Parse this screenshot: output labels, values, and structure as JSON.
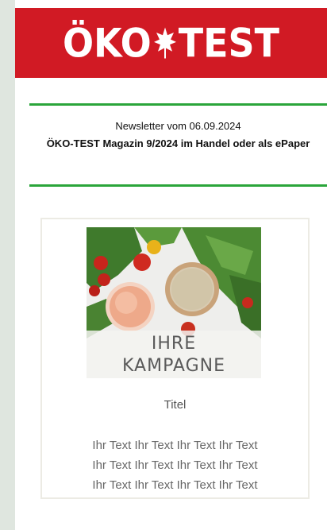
{
  "header": {
    "logo_left": "ÖKO",
    "logo_right": "TEST",
    "brand_color": "#d11a24"
  },
  "newsletter": {
    "date_line": "Newsletter vom 06.09.2024",
    "headline": "ÖKO-TEST Magazin 9/2024 im Handel oder als ePaper",
    "rule_color": "#2aa53a"
  },
  "campaign": {
    "image_line1": "IHRE",
    "image_line2": "KAMPAGNE",
    "title": "Titel",
    "body_lines": [
      "Ihr Text Ihr Text Ihr Text Ihr Text",
      "Ihr Text Ihr Text Ihr Text Ihr Text",
      "Ihr Text Ihr Text Ihr Text Ihr Text"
    ]
  }
}
